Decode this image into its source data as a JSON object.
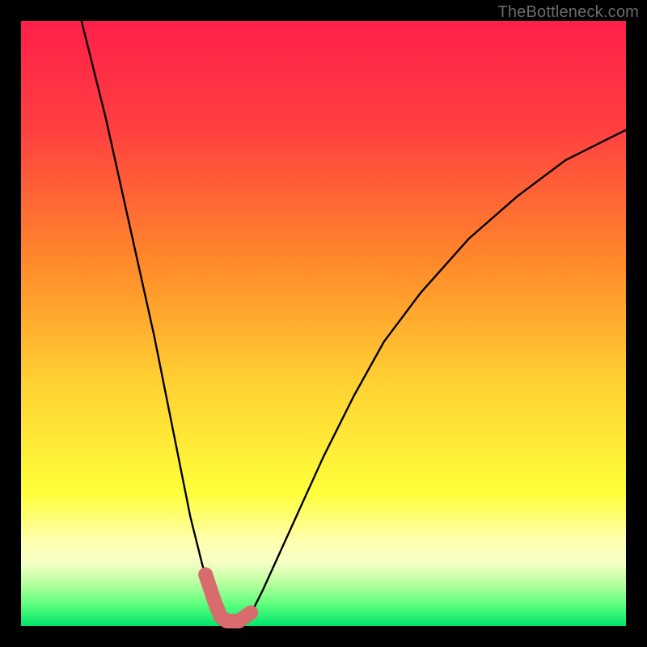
{
  "watermark": "TheBottleneck.com",
  "colors": {
    "black": "#000000",
    "curve": "#000000",
    "marker": "#d86b6b",
    "gradient_stops": [
      {
        "offset": 0.0,
        "color": "#ff1f4a"
      },
      {
        "offset": 0.18,
        "color": "#ff4040"
      },
      {
        "offset": 0.4,
        "color": "#ff8a2a"
      },
      {
        "offset": 0.6,
        "color": "#ffd233"
      },
      {
        "offset": 0.78,
        "color": "#ffff3a"
      },
      {
        "offset": 0.86,
        "color": "#ffffb0"
      },
      {
        "offset": 0.895,
        "color": "#f6ffc6"
      },
      {
        "offset": 0.93,
        "color": "#b8ff9e"
      },
      {
        "offset": 0.965,
        "color": "#5cff7e"
      },
      {
        "offset": 1.0,
        "color": "#00e46a"
      }
    ]
  },
  "chart_data": {
    "type": "line",
    "title": "",
    "xlabel": "",
    "ylabel": "",
    "xlim": [
      0,
      100
    ],
    "ylim": [
      0,
      100
    ],
    "grid": false,
    "series": [
      {
        "name": "bottleneck-curve",
        "x": [
          10,
          14,
          18,
          22,
          26,
          28,
          30,
          32,
          33,
          34,
          35,
          36,
          38,
          40,
          45,
          50,
          55,
          60,
          66,
          74,
          82,
          90,
          96,
          100
        ],
        "y": [
          100,
          84,
          66,
          48,
          28,
          18,
          10,
          4,
          1.5,
          0.6,
          0.6,
          0.6,
          2,
          6,
          17,
          28,
          38,
          47,
          55,
          64,
          71,
          77,
          80,
          82
        ]
      }
    ],
    "markers": {
      "name": "highlight-points",
      "x": [
        30.5,
        32,
        33,
        34,
        35,
        36,
        38
      ],
      "y": [
        8.5,
        4,
        1.5,
        0.8,
        0.8,
        0.8,
        2.2
      ]
    },
    "marker_dot": {
      "x": 30.5,
      "y": 8.5
    }
  }
}
